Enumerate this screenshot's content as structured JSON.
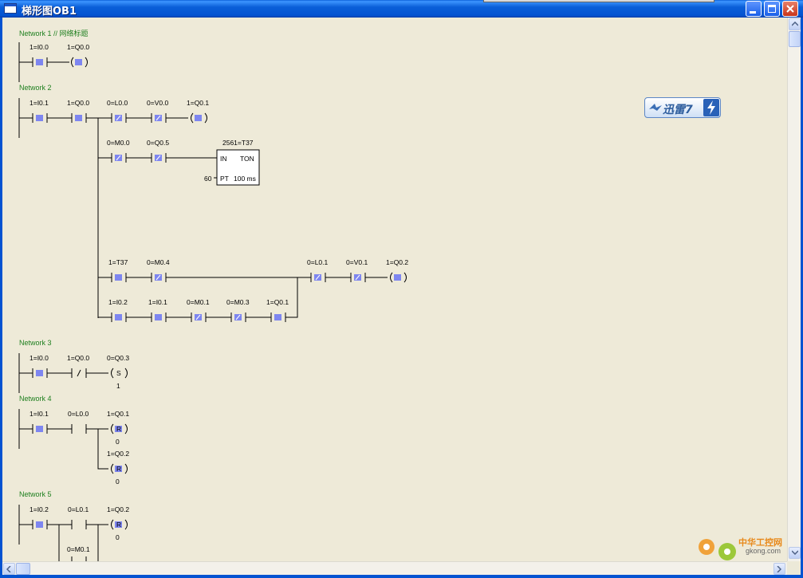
{
  "window": {
    "title": "梯形图OB1",
    "buttons": [
      "minimize",
      "maximize",
      "close"
    ]
  },
  "networks": [
    {
      "label": "Network 1 // 网络标题"
    },
    {
      "label": "Network 2"
    },
    {
      "label": "Network 3"
    },
    {
      "label": "Network 4"
    },
    {
      "label": "Network 5"
    }
  ],
  "ladder": {
    "n1": {
      "c1": "1=I0.0",
      "coil": "1=Q0.0"
    },
    "n2": {
      "r1": [
        "1=I0.1",
        "1=Q0.0",
        "0=L0.0",
        "0=V0.0"
      ],
      "r1_coil": "1=Q0.1",
      "r2": [
        "0=M0.0",
        "0=Q0.5"
      ],
      "timer": {
        "name": "2561=T37",
        "in": "IN",
        "type": "TON",
        "pt": "PT",
        "base": "100 ms",
        "preset": "60"
      },
      "r3": [
        "1=T37",
        "0=M0.4"
      ],
      "r3b": [
        "0=L0.1",
        "0=V0.1"
      ],
      "r3_coil": "1=Q0.2",
      "r4": [
        "1=I0.2",
        "1=I0.1",
        "0=M0.1",
        "0=M0.3",
        "1=Q0.1"
      ]
    },
    "n3": {
      "c": [
        "1=I0.0",
        "1=Q0.0"
      ],
      "coil": "0=Q0.3",
      "coil_letter": "S",
      "n": "1"
    },
    "n4": {
      "c": [
        "1=I0.1",
        "0=L0.0"
      ],
      "coil1": "1=Q0.1",
      "coil2": "1=Q0.2",
      "coil_letter": "R",
      "n1": "0",
      "n2": "0"
    },
    "n5": {
      "c": [
        "1=I0.2",
        "0=L0.1"
      ],
      "coil": "1=Q0.2",
      "coil_letter": "R",
      "n": "0",
      "branch": "0=M0.1"
    }
  },
  "badge": {
    "text": "迅雷7"
  },
  "watermark": {
    "title": "中华工控网",
    "url": "gkong.com"
  },
  "colors": {
    "titlebar": "#0A5FD8",
    "network_label": "#1E7F1E",
    "energized": "#7E86F0",
    "background": "#EEEAD8"
  }
}
